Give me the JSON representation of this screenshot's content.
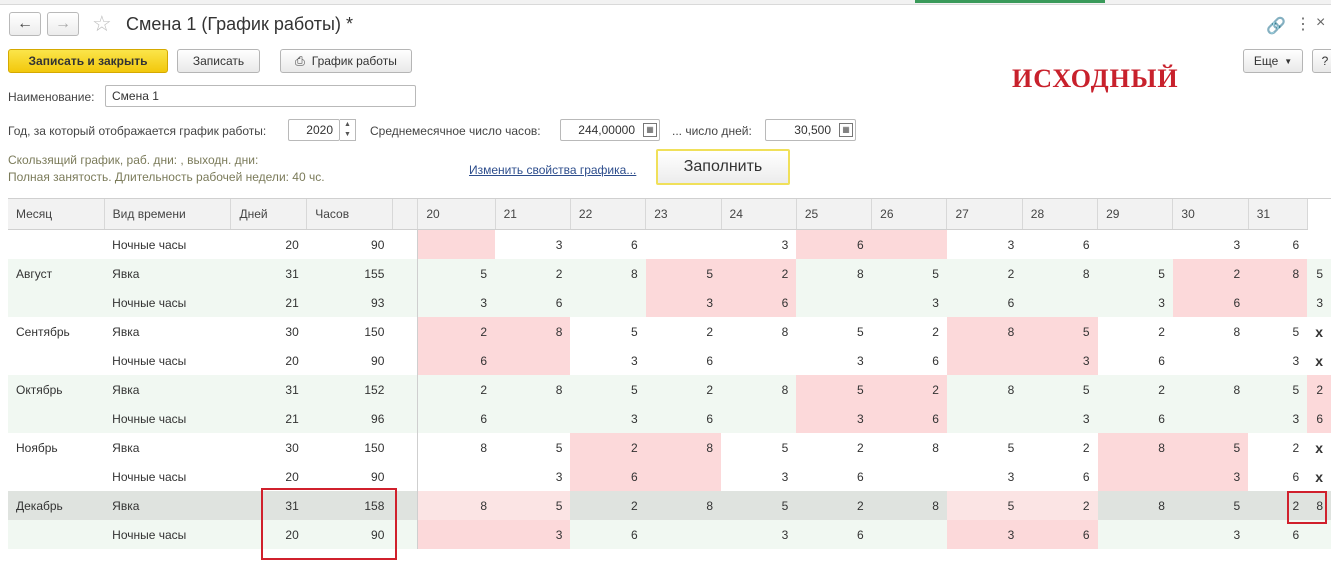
{
  "window": {
    "title": "Смена 1 (График работы) *"
  },
  "toolbar": {
    "save_close": "Записать и закрыть",
    "save": "Записать",
    "schedule": "График работы",
    "more": "Еще"
  },
  "stamp_text": "ИСХОДНЫЙ",
  "form": {
    "name_label": "Наименование:",
    "name_value": "Смена 1",
    "year_label": "Год, за который отображается график работы:",
    "year_value": "2020",
    "avg_hours_label": "Среднемесячное число часов:",
    "avg_hours_value": "244,00000",
    "days_label": "... число дней:",
    "days_value": "30,500",
    "info_line1": "Скользящий график, раб. дни: , выходн. дни:",
    "info_line2": "Полная занятость. Длительность рабочей недели: 40 чс.",
    "change_link": "Изменить свойства графика...",
    "fill_button": "Заполнить"
  },
  "grid": {
    "headers": [
      "Месяц",
      "Вид времени",
      "Дней",
      "Часов",
      "",
      "20",
      "21",
      "22",
      "23",
      "24",
      "25",
      "26",
      "27",
      "28",
      "29",
      "30",
      "31"
    ],
    "rows": [
      {
        "style": "w",
        "month": "",
        "kind": "Ночные часы",
        "days": "20",
        "hours": "90",
        "cells": [
          "",
          "3",
          "6",
          "",
          "3",
          "6",
          "",
          "3",
          "6",
          "",
          "3",
          "6",
          ""
        ],
        "hl": [
          0,
          5,
          6
        ]
      },
      {
        "style": "g",
        "month": "Август",
        "kind": "Явка",
        "days": "31",
        "hours": "155",
        "cells": [
          "5",
          "2",
          "8",
          "5",
          "2",
          "8",
          "5",
          "2",
          "8",
          "5",
          "2",
          "8",
          "5"
        ],
        "hl": [
          3,
          4,
          10,
          11
        ]
      },
      {
        "style": "g",
        "month": "",
        "kind": "Ночные часы",
        "days": "21",
        "hours": "93",
        "cells": [
          "3",
          "6",
          "",
          "3",
          "6",
          "",
          "3",
          "6",
          "",
          "3",
          "6",
          "",
          "3"
        ],
        "hl": [
          3,
          4,
          10,
          11
        ]
      },
      {
        "style": "w",
        "month": "Сентябрь",
        "kind": "Явка",
        "days": "30",
        "hours": "150",
        "cells": [
          "2",
          "8",
          "5",
          "2",
          "8",
          "5",
          "2",
          "8",
          "5",
          "2",
          "8",
          "5",
          "x"
        ],
        "hl": [
          0,
          1,
          7,
          8
        ]
      },
      {
        "style": "w",
        "month": "",
        "kind": "Ночные часы",
        "days": "20",
        "hours": "90",
        "cells": [
          "6",
          "",
          "3",
          "6",
          "",
          "3",
          "6",
          "",
          "3",
          "6",
          "",
          "3",
          "x"
        ],
        "hl": [
          0,
          1,
          7,
          8
        ]
      },
      {
        "style": "g",
        "month": "Октябрь",
        "kind": "Явка",
        "days": "31",
        "hours": "152",
        "cells": [
          "2",
          "8",
          "5",
          "2",
          "8",
          "5",
          "2",
          "8",
          "5",
          "2",
          "8",
          "5",
          "2"
        ],
        "hl": [
          5,
          6,
          12
        ]
      },
      {
        "style": "g",
        "month": "",
        "kind": "Ночные часы",
        "days": "21",
        "hours": "96",
        "cells": [
          "6",
          "",
          "3",
          "6",
          "",
          "3",
          "6",
          "",
          "3",
          "6",
          "",
          "3",
          "6"
        ],
        "hl": [
          5,
          6,
          12
        ]
      },
      {
        "style": "w",
        "month": "Ноябрь",
        "kind": "Явка",
        "days": "30",
        "hours": "150",
        "cells": [
          "8",
          "5",
          "2",
          "8",
          "5",
          "2",
          "8",
          "5",
          "2",
          "8",
          "5",
          "2",
          "x"
        ],
        "hl": [
          2,
          3,
          9,
          10
        ]
      },
      {
        "style": "w",
        "month": "",
        "kind": "Ночные часы",
        "days": "20",
        "hours": "90",
        "cells": [
          "",
          "3",
          "6",
          "",
          "3",
          "6",
          "",
          "3",
          "6",
          "",
          "3",
          "6",
          "x"
        ],
        "hl": [
          2,
          3,
          9,
          10
        ]
      },
      {
        "style": "sel",
        "month": "Декабрь",
        "kind": "Явка",
        "days": "31",
        "hours": "158",
        "cells": [
          "8",
          "5",
          "2",
          "8",
          "5",
          "2",
          "8",
          "5",
          "2",
          "8",
          "5",
          "2",
          "8"
        ],
        "hl": [
          0,
          1,
          7,
          8
        ]
      },
      {
        "style": "g",
        "month": "",
        "kind": "Ночные часы",
        "days": "20",
        "hours": "90",
        "cells": [
          "",
          "3",
          "6",
          "",
          "3",
          "6",
          "",
          "3",
          "6",
          "",
          "3",
          "6",
          ""
        ],
        "hl": [
          0,
          1,
          7,
          8
        ]
      }
    ]
  }
}
